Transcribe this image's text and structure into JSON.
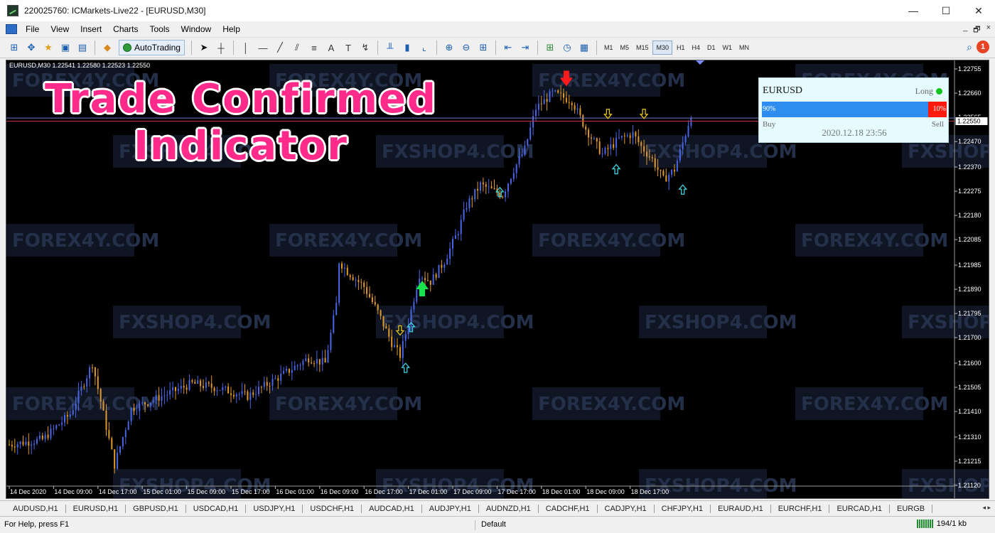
{
  "window": {
    "title": "220025760: ICMarkets-Live22 - [EURUSD,M30]",
    "controls": {
      "minimize": "—",
      "maximize": "☐",
      "close": "✕"
    }
  },
  "menu": {
    "items": [
      "File",
      "View",
      "Insert",
      "Charts",
      "Tools",
      "Window",
      "Help"
    ],
    "mdi_controls": {
      "minimize": "_",
      "restore": "🗗",
      "close": "×"
    }
  },
  "toolbar": {
    "autotrading_label": "AutoTrading",
    "timeframes": [
      "M1",
      "M5",
      "M15",
      "M30",
      "H1",
      "H4",
      "D1",
      "W1",
      "MN"
    ],
    "active_timeframe": "M30",
    "notification_count": "1"
  },
  "chart": {
    "header": "EURUSD,M30  1.22541 1.22580 1.22523 1.22550",
    "promo_lines": [
      "Trade Confirmed",
      "Indicator"
    ],
    "panel": {
      "symbol": "EURUSD",
      "direction": "Long",
      "buy_percent_label": "90%",
      "sell_percent_label": "10%",
      "buy_fraction": 0.9,
      "buy_label": "Buy",
      "sell_label": "Sell",
      "time": "2020.12.18 23:56"
    },
    "watermarks": {
      "a": "FOREX4Y",
      "b": "FXSHOP4",
      "suffix": ".COM"
    },
    "colors": {
      "bull": "#4a66e6",
      "bear": "#e09a2b",
      "bid_line": "#c0303a",
      "ask_line": "#6a78c8"
    }
  },
  "chart_data": {
    "type": "candlestick",
    "symbol": "EURUSD",
    "timeframe": "M30",
    "y_ticks": [
      "1.22755",
      "1.22660",
      "1.22565",
      "1.22470",
      "1.22370",
      "1.22275",
      "1.22180",
      "1.22085",
      "1.21985",
      "1.21890",
      "1.21795",
      "1.21700",
      "1.21600",
      "1.21505",
      "1.21410",
      "1.21310",
      "1.21215",
      "1.21120"
    ],
    "ylim": [
      1.2112,
      1.22755
    ],
    "current_price": "1.22550",
    "bid": 1.2255,
    "ask": 1.22562,
    "x_ticks": [
      "14 Dec 2020",
      "14 Dec 09:00",
      "14 Dec 17:00",
      "15 Dec 01:00",
      "15 Dec 09:00",
      "15 Dec 17:00",
      "16 Dec 01:00",
      "16 Dec 09:00",
      "16 Dec 17:00",
      "17 Dec 01:00",
      "17 Dec 09:00",
      "17 Dec 17:00",
      "18 Dec 01:00",
      "18 Dec 09:00",
      "18 Dec 17:00"
    ],
    "bar_count": 240,
    "price_path": [
      [
        0,
        1.2128
      ],
      [
        12,
        1.213
      ],
      [
        22,
        1.214
      ],
      [
        30,
        1.216
      ],
      [
        32,
        1.215
      ],
      [
        38,
        1.212
      ],
      [
        44,
        1.2142
      ],
      [
        55,
        1.2147
      ],
      [
        66,
        1.2152
      ],
      [
        76,
        1.215
      ],
      [
        86,
        1.2147
      ],
      [
        98,
        1.2155
      ],
      [
        108,
        1.2162
      ],
      [
        114,
        1.216
      ],
      [
        118,
        1.2183
      ],
      [
        119,
        1.22
      ],
      [
        122,
        1.2196
      ],
      [
        128,
        1.219
      ],
      [
        133,
        1.218
      ],
      [
        138,
        1.2168
      ],
      [
        141,
        1.2163
      ],
      [
        144,
        1.2176
      ],
      [
        148,
        1.2195
      ],
      [
        152,
        1.2192
      ],
      [
        157,
        1.22
      ],
      [
        162,
        1.2212
      ],
      [
        165,
        1.2222
      ],
      [
        170,
        1.223
      ],
      [
        178,
        1.2226
      ],
      [
        182,
        1.2236
      ],
      [
        186,
        1.2244
      ],
      [
        190,
        1.226
      ],
      [
        196,
        1.2266
      ],
      [
        203,
        1.2263
      ],
      [
        208,
        1.2252
      ],
      [
        214,
        1.2242
      ],
      [
        220,
        1.2248
      ],
      [
        225,
        1.225
      ],
      [
        228,
        1.2245
      ],
      [
        232,
        1.224
      ],
      [
        236,
        1.2232
      ],
      [
        240,
        1.2236
      ],
      [
        244,
        1.225
      ],
      [
        246,
        1.2258
      ]
    ],
    "signals": [
      {
        "type": "buy-big",
        "bar": 149,
        "price": 1.2189
      },
      {
        "type": "sell-big",
        "bar": 201,
        "price": 1.2272
      },
      {
        "type": "buy-small",
        "bar": 143,
        "price": 1.2158
      },
      {
        "type": "buy-small",
        "bar": 145,
        "price": 1.2174
      },
      {
        "type": "buy-small",
        "bar": 177,
        "price": 1.2227
      },
      {
        "type": "buy-small",
        "bar": 219,
        "price": 1.2236
      },
      {
        "type": "buy-small",
        "bar": 243,
        "price": 1.2228
      },
      {
        "type": "sell-small",
        "bar": 141,
        "price": 1.2173
      },
      {
        "type": "sell-small",
        "bar": 216,
        "price": 1.2258
      },
      {
        "type": "sell-small",
        "bar": 229,
        "price": 1.2258
      }
    ]
  },
  "symbol_tabs": [
    "AUDUSD,H1",
    "EURUSD,H1",
    "GBPUSD,H1",
    "USDCAD,H1",
    "USDJPY,H1",
    "USDCHF,H1",
    "AUDCAD,H1",
    "AUDJPY,H1",
    "AUDNZD,H1",
    "CADCHF,H1",
    "CADJPY,H1",
    "CHFJPY,H1",
    "EURAUD,H1",
    "EURCHF,H1",
    "EURCAD,H1",
    "EURGB"
  ],
  "status": {
    "help": "For Help, press F1",
    "profile": "Default",
    "traffic": "194/1 kb"
  }
}
